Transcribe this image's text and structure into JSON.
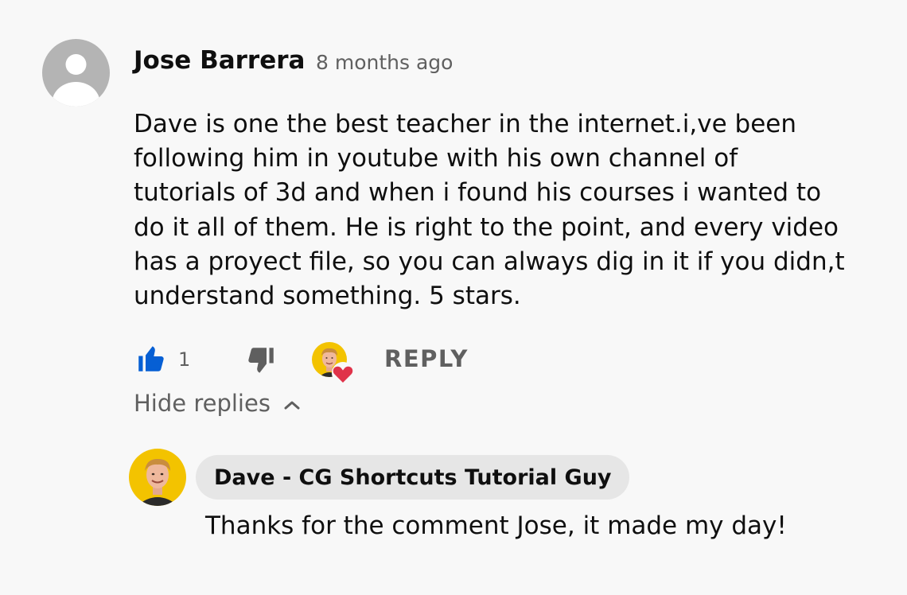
{
  "comment": {
    "author": "Jose Barrera",
    "timestamp": "8 months ago",
    "avatar_icon": "default-user-avatar",
    "body_lines": [
      "Dave is one the best teacher in the internet.i,ve been",
      "following him in youtube with his own channel of",
      "tutorials of 3d and when i found his courses i wanted to",
      "do it all of them. He is right to the point, and every video",
      "has a proyect file, so you can always dig in it if you didn,t",
      "understand something. 5 stars."
    ],
    "actions": {
      "like_icon": "thumbs-up-icon",
      "like_count": "1",
      "like_color": "#065fd4",
      "dislike_icon": "thumbs-down-icon",
      "creator_heart_icon": "creator-heart-icon",
      "heart_color": "#e0334a",
      "reply_label": "REPLY"
    },
    "hide_replies_label": "Hide replies",
    "hide_replies_icon": "chevron-up-icon"
  },
  "reply": {
    "author": "Dave - CG Shortcuts Tutorial Guy",
    "avatar_background": "#f3c300",
    "body": "Thanks for the comment Jose, it made my day!"
  }
}
